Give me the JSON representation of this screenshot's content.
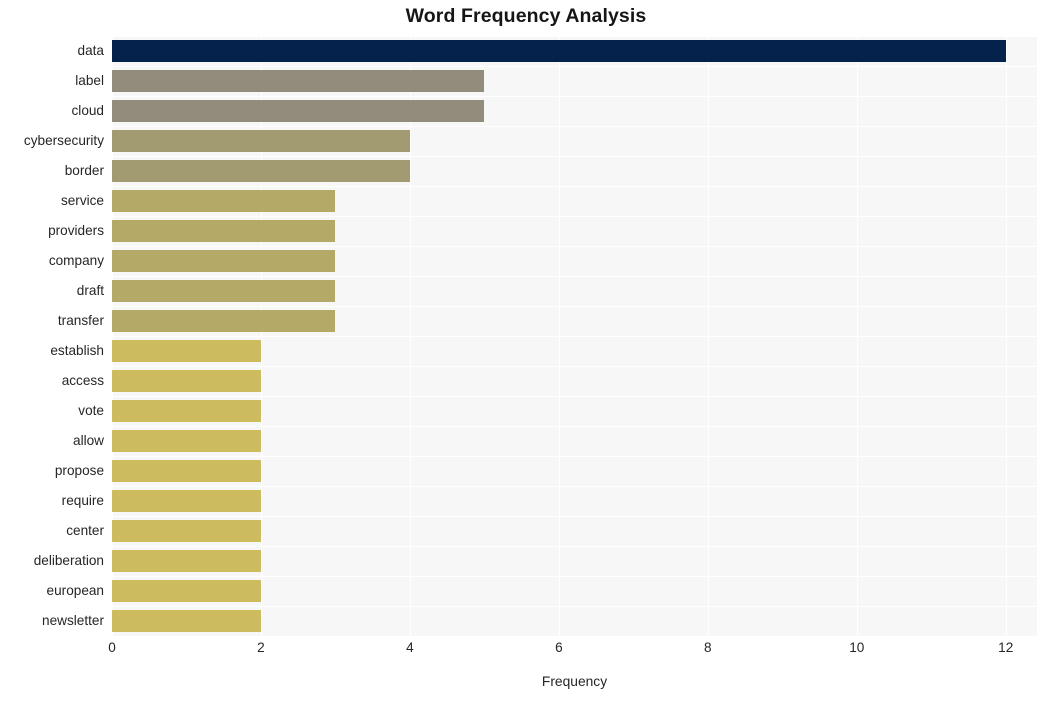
{
  "chart_data": {
    "type": "bar",
    "orientation": "horizontal",
    "title": "Word Frequency Analysis",
    "xlabel": "Frequency",
    "ylabel": "",
    "xlim": [
      0,
      12.42
    ],
    "xticks": [
      0,
      2,
      4,
      6,
      8,
      10,
      12
    ],
    "xtick_labels": [
      "0",
      "2",
      "4",
      "6",
      "8",
      "10",
      "12"
    ],
    "grid": true,
    "legend": "none",
    "plot_background": "#f7f7f7",
    "gridline_color": "#ffffff",
    "categories": [
      "data",
      "label",
      "cloud",
      "cybersecurity",
      "border",
      "service",
      "providers",
      "company",
      "draft",
      "transfer",
      "establish",
      "access",
      "vote",
      "allow",
      "propose",
      "require",
      "center",
      "deliberation",
      "european",
      "newsletter"
    ],
    "values": [
      12,
      5,
      5,
      4,
      4,
      3,
      3,
      3,
      3,
      3,
      2,
      2,
      2,
      2,
      2,
      2,
      2,
      2,
      2,
      2
    ],
    "bar_colors": [
      "#04224c",
      "#918c7c",
      "#918c7c",
      "#a29a71",
      "#a29a71",
      "#b5a968",
      "#b5a968",
      "#b5a968",
      "#b5a968",
      "#b5a968",
      "#cdbc5f",
      "#cdbc5f",
      "#cdbc5f",
      "#cdbc5f",
      "#cdbc5f",
      "#cdbc5f",
      "#cdbc5f",
      "#cdbc5f",
      "#cdbc5f",
      "#cdbc5f"
    ]
  }
}
